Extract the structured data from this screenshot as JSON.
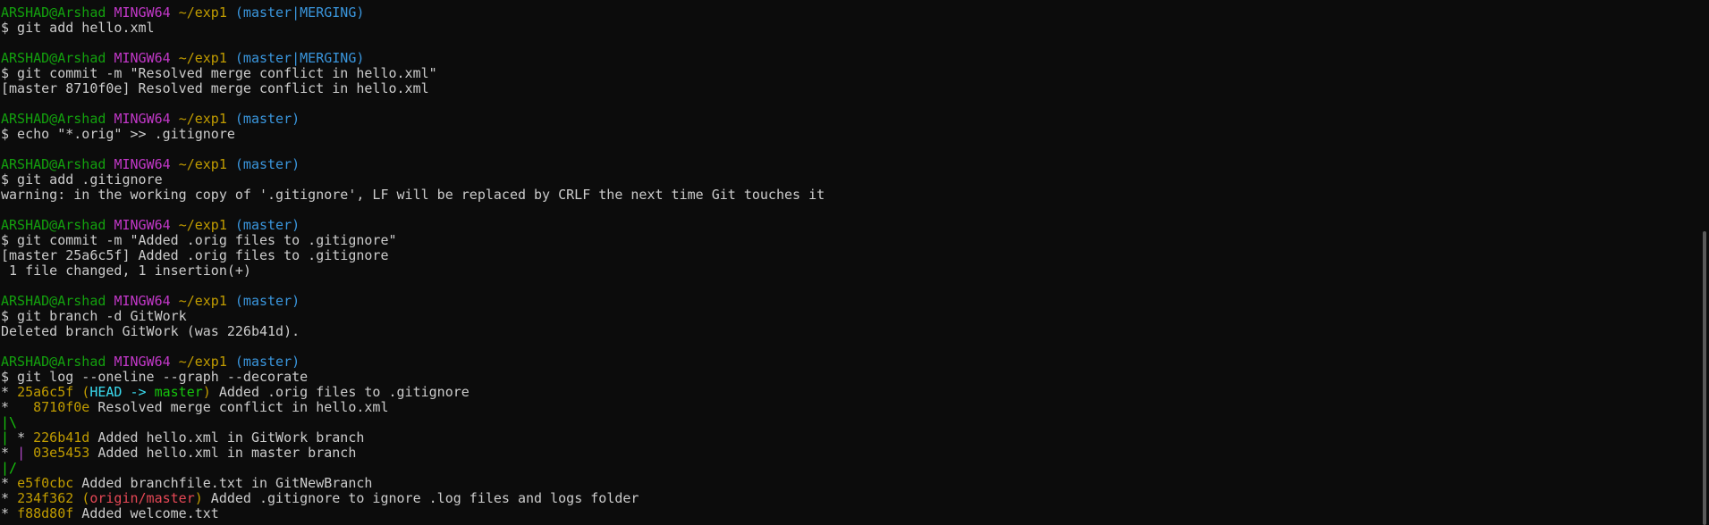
{
  "colors": {
    "background": "#0c0c0c",
    "text": "#cccccc",
    "user": "#13a10e",
    "msystem": "#c238c8",
    "path": "#c19c00",
    "branch": "#3a96dd",
    "hash": "#c19c00",
    "head": "#3adcf0",
    "master_ref": "#16c60c",
    "remote_ref": "#e74856",
    "graph_green": "#16c60c",
    "graph_yellow": "#c19c00",
    "graph_purple": "#b148c6"
  },
  "scrollbar": {
    "thumb_top_fraction": 0.44,
    "thumb_size_fraction": 0.56
  },
  "lines": [
    [
      {
        "t": "ARSHAD@Arshad ",
        "c": "user"
      },
      {
        "t": "MINGW64 ",
        "c": "msystem"
      },
      {
        "t": "~/exp1 ",
        "c": "path"
      },
      {
        "t": "(master|MERGING)",
        "c": "branch"
      }
    ],
    [
      {
        "t": "$ git add hello.xml",
        "c": "text"
      }
    ],
    [],
    [
      {
        "t": "ARSHAD@Arshad ",
        "c": "user"
      },
      {
        "t": "MINGW64 ",
        "c": "msystem"
      },
      {
        "t": "~/exp1 ",
        "c": "path"
      },
      {
        "t": "(master|MERGING)",
        "c": "branch"
      }
    ],
    [
      {
        "t": "$ git commit -m \"Resolved merge conflict in hello.xml\"",
        "c": "text"
      }
    ],
    [
      {
        "t": "[master 8710f0e] Resolved merge conflict in hello.xml",
        "c": "text"
      }
    ],
    [],
    [
      {
        "t": "ARSHAD@Arshad ",
        "c": "user"
      },
      {
        "t": "MINGW64 ",
        "c": "msystem"
      },
      {
        "t": "~/exp1 ",
        "c": "path"
      },
      {
        "t": "(master)",
        "c": "branch"
      }
    ],
    [
      {
        "t": "$ echo \"*.orig\" >> .gitignore",
        "c": "text"
      }
    ],
    [],
    [
      {
        "t": "ARSHAD@Arshad ",
        "c": "user"
      },
      {
        "t": "MINGW64 ",
        "c": "msystem"
      },
      {
        "t": "~/exp1 ",
        "c": "path"
      },
      {
        "t": "(master)",
        "c": "branch"
      }
    ],
    [
      {
        "t": "$ git add .gitignore",
        "c": "text"
      }
    ],
    [
      {
        "t": "warning: in the working copy of '.gitignore', LF will be replaced by CRLF the next time Git touches it",
        "c": "text"
      }
    ],
    [],
    [
      {
        "t": "ARSHAD@Arshad ",
        "c": "user"
      },
      {
        "t": "MINGW64 ",
        "c": "msystem"
      },
      {
        "t": "~/exp1 ",
        "c": "path"
      },
      {
        "t": "(master)",
        "c": "branch"
      }
    ],
    [
      {
        "t": "$ git commit -m \"Added .orig files to .gitignore\"",
        "c": "text"
      }
    ],
    [
      {
        "t": "[master 25a6c5f] Added .orig files to .gitignore",
        "c": "text"
      }
    ],
    [
      {
        "t": " 1 file changed, 1 insertion(+)",
        "c": "text"
      }
    ],
    [],
    [
      {
        "t": "ARSHAD@Arshad ",
        "c": "user"
      },
      {
        "t": "MINGW64 ",
        "c": "msystem"
      },
      {
        "t": "~/exp1 ",
        "c": "path"
      },
      {
        "t": "(master)",
        "c": "branch"
      }
    ],
    [
      {
        "t": "$ git branch -d GitWork",
        "c": "text"
      }
    ],
    [
      {
        "t": "Deleted branch GitWork (was 226b41d).",
        "c": "text"
      }
    ],
    [],
    [
      {
        "t": "ARSHAD@Arshad ",
        "c": "user"
      },
      {
        "t": "MINGW64 ",
        "c": "msystem"
      },
      {
        "t": "~/exp1 ",
        "c": "path"
      },
      {
        "t": "(master)",
        "c": "branch"
      }
    ],
    [
      {
        "t": "$ git log --oneline --graph --decorate",
        "c": "text"
      }
    ],
    [
      {
        "t": "* ",
        "c": "text"
      },
      {
        "t": "25a6c5f ",
        "c": "hash"
      },
      {
        "t": "(",
        "c": "hash"
      },
      {
        "t": "HEAD -> ",
        "c": "head"
      },
      {
        "t": "master",
        "c": "master_ref"
      },
      {
        "t": ")",
        "c": "hash"
      },
      {
        "t": " Added .orig files to .gitignore",
        "c": "text"
      }
    ],
    [
      {
        "t": "*   ",
        "c": "text"
      },
      {
        "t": "8710f0e",
        "c": "hash"
      },
      {
        "t": " Resolved merge conflict in hello.xml",
        "c": "text"
      }
    ],
    [
      {
        "t": "|\\",
        "c": "graph_green"
      }
    ],
    [
      {
        "t": "| ",
        "c": "graph_green"
      },
      {
        "t": "* ",
        "c": "text"
      },
      {
        "t": "226b41d",
        "c": "hash"
      },
      {
        "t": " Added hello.xml in GitWork branch",
        "c": "text"
      }
    ],
    [
      {
        "t": "* ",
        "c": "text"
      },
      {
        "t": "| ",
        "c": "graph_purple"
      },
      {
        "t": "03e5453",
        "c": "hash"
      },
      {
        "t": " Added hello.xml in master branch",
        "c": "text"
      }
    ],
    [
      {
        "t": "|/",
        "c": "graph_green"
      }
    ],
    [
      {
        "t": "* ",
        "c": "text"
      },
      {
        "t": "e5f0cbc",
        "c": "hash"
      },
      {
        "t": " Added branchfile.txt in GitNewBranch",
        "c": "text"
      }
    ],
    [
      {
        "t": "* ",
        "c": "text"
      },
      {
        "t": "234f362 ",
        "c": "hash"
      },
      {
        "t": "(",
        "c": "hash"
      },
      {
        "t": "origin/master",
        "c": "remote_ref"
      },
      {
        "t": ")",
        "c": "hash"
      },
      {
        "t": " Added .gitignore to ignore .log files and logs folder",
        "c": "text"
      }
    ],
    [
      {
        "t": "* ",
        "c": "text"
      },
      {
        "t": "f88d80f",
        "c": "hash"
      },
      {
        "t": " Added welcome.txt",
        "c": "text"
      }
    ]
  ]
}
